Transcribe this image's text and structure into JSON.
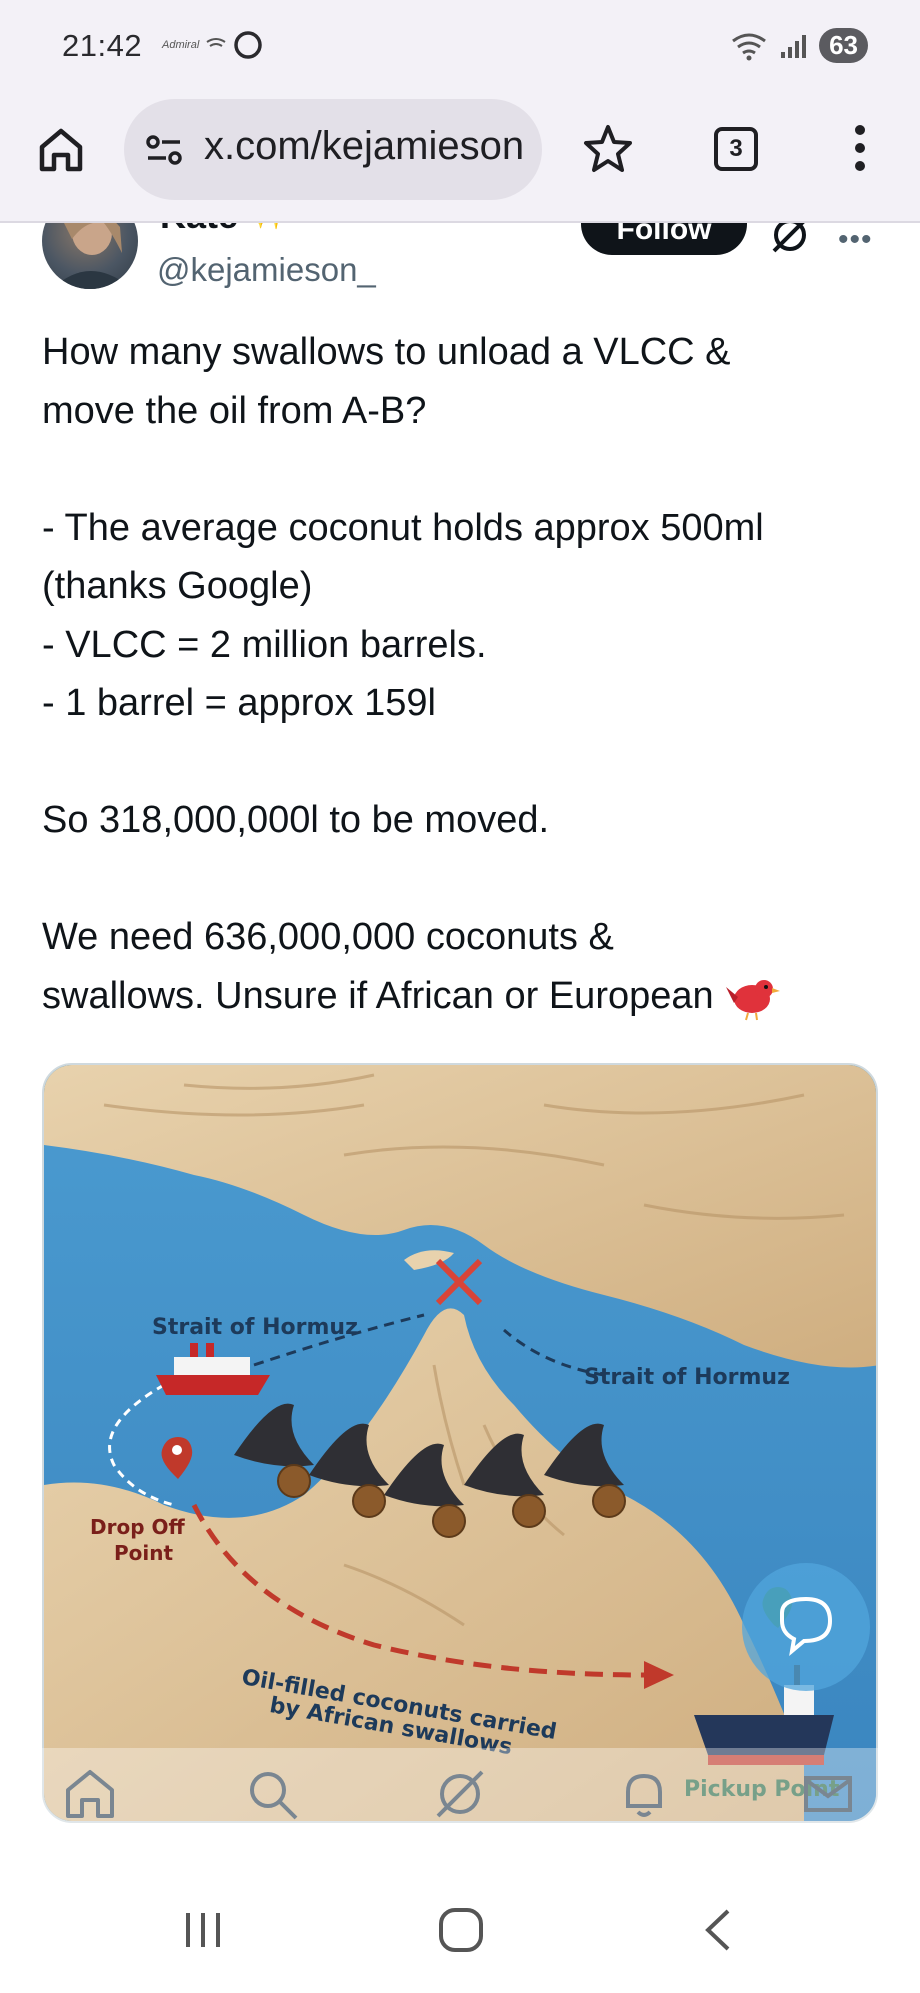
{
  "status_bar": {
    "time": "21:42",
    "carrier_icon": "Admiral",
    "battery": "63",
    "icons": [
      "carrier-logo-icon",
      "circle-icon",
      "wifi-icon",
      "signal-icon"
    ]
  },
  "browser": {
    "url": "x.com/kejamieson",
    "tab_count": "3",
    "icons": [
      "home-icon",
      "site-info-icon",
      "star-icon",
      "tabs-icon",
      "menu-icon"
    ]
  },
  "post": {
    "display_name": "Kate",
    "name_emoji": "✨",
    "handle": "@kejamieson_",
    "follow_label": "Follow",
    "text_lines": [
      "How many swallows to unload a VLCC &",
      "move the oil from A-B?",
      "",
      "- The average coconut holds approx 500ml",
      "(thanks Google)",
      "- VLCC = 2 million barrels.",
      "- 1 barrel = approx 159l",
      "",
      "So 318,000,000l to be moved.",
      "",
      "We need 636,000,000 coconuts &",
      "swallows. Unsure if African or European"
    ]
  },
  "media": {
    "labels": {
      "strait_left": "Strait of Hormuz",
      "strait_right": "Strait of Hormuz",
      "drop_off_1": "Drop Off",
      "drop_off_2": "Point",
      "route_1": "Oil-filled coconuts carried",
      "route_2": "by African swallows",
      "pickup": "Pickup Point"
    },
    "colors": {
      "sea": "#3f8fc4",
      "land": "#dcc39c",
      "route": "#c0392b"
    }
  },
  "bottom_nav": {
    "items": [
      "home-icon",
      "search-icon",
      "grok-icon",
      "notifications-icon",
      "messages-icon"
    ]
  },
  "system_nav": {
    "items": [
      "recent-apps-icon",
      "home-circle-icon",
      "back-icon"
    ]
  }
}
